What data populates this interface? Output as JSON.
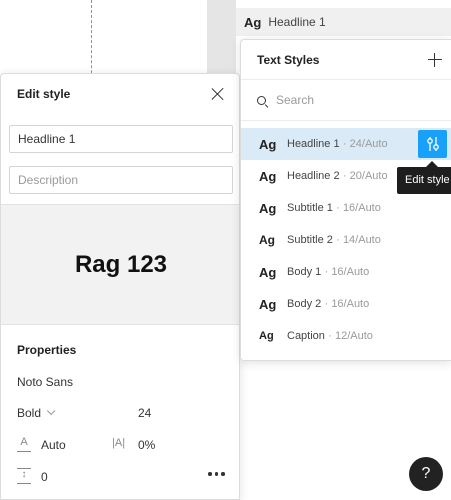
{
  "layer_chip": {
    "ag": "Ag",
    "name": "Headline 1"
  },
  "edit_style": {
    "title": "Edit style",
    "name_value": "Headline 1",
    "description_placeholder": "Description",
    "preview_text": "Rag 123",
    "properties_title": "Properties",
    "font_family": "Noto Sans",
    "font_weight": "Bold",
    "font_size": "24",
    "line_height": "Auto",
    "letter_spacing": "0%",
    "paragraph_spacing": "0",
    "line_height_icon": "A",
    "letter_spacing_icon": "|A|",
    "paragraph_spacing_icon": "↕"
  },
  "text_styles": {
    "title": "Text Styles",
    "search_placeholder": "Search",
    "items": [
      {
        "ag": "Ag",
        "name": "Headline 1",
        "meta": "· 24/Auto",
        "ag_size": 13,
        "selected": true
      },
      {
        "ag": "Ag",
        "name": "Headline 2",
        "meta": "· 20/Auto",
        "ag_size": 13,
        "selected": false
      },
      {
        "ag": "Ag",
        "name": "Subtitle 1",
        "meta": "· 16/Auto",
        "ag_size": 13,
        "selected": false
      },
      {
        "ag": "Ag",
        "name": "Subtitle 2",
        "meta": "· 14/Auto",
        "ag_size": 12,
        "selected": false
      },
      {
        "ag": "Ag",
        "name": "Body 1",
        "meta": "· 16/Auto",
        "ag_size": 13,
        "selected": false
      },
      {
        "ag": "Ag",
        "name": "Body 2",
        "meta": "· 16/Auto",
        "ag_size": 13,
        "selected": false
      },
      {
        "ag": "Ag",
        "name": "Caption",
        "meta": "· 12/Auto",
        "ag_size": 11,
        "selected": false
      }
    ]
  },
  "tooltip": "Edit style",
  "help_label": "?",
  "colors": {
    "accent": "#18a0fb",
    "selected_row": "#daebf7",
    "guide": "#47a3f3"
  }
}
